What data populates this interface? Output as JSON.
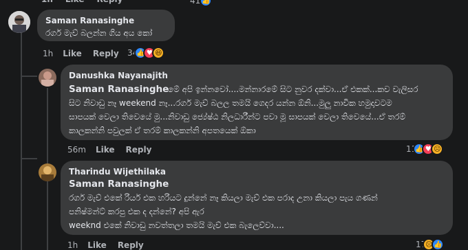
{
  "top_partial": {
    "time": "1h",
    "like": "Like",
    "reply": "Reply",
    "count": "41"
  },
  "comments": [
    {
      "author": "Saman Ranasinghe",
      "text_lines": [
        "රගර් මැච් බලන්න ගිය අය කෝ"
      ],
      "time": "1h",
      "like": "Like",
      "reply": "Reply",
      "reaction_count": "34",
      "reactions": [
        "like-icon",
        "love-icon",
        "haha-icon"
      ]
    },
    {
      "author": "Danushka Nayanajith",
      "mention": "Saman Ranasinghe",
      "text_lines": [
        "මේ අපි ඉන්නවෝ....මන්නාරමේ සිට නුවර දක්වා...ඒ එකක්...කව වැලිසර",
        "සිට නිවාඩු නෑ weekend නෑ...රගර් මැච් බලල තමයි ගෙදර යන්න ඕනි...මුලු නාවික හමුදාවටම",
        "සාපයක් වෙලා තිවෙයේ මු...නිවාඩු ජ්‍යේෂ්ඨ නිලධාරීන්ට පවා මූ සාපයක් වෙලා තිවෙයේ...ඒ තරම්",
        "කාලකන්නි පවුලක් ඒ තරම් කාලකන්නි අපතයෙක් ඕකා"
      ],
      "time": "56m",
      "like": "Like",
      "reply": "Reply",
      "reaction_count": "11",
      "reactions": [
        "like-icon",
        "love-icon",
        "sad-icon"
      ]
    },
    {
      "author": "Tharindu Wijethilaka",
      "mention": "Saman Ranasinghe",
      "text_lines": [
        "රගර් මැච් එකේ රියර් එක හරියට දුන්නේ නෑ කියලා මැච් එක පරාද උනා කියලා පැය ගණන්",
        "පනිෂ්මන්ට් කරපු එක ද දන්නේ? අපි ඇර",
        "weeknd එකේ නිවාඩු නවත්තලා තමයි මැච් එක බැලෙව්වා...."
      ],
      "time": "1h",
      "like": "Like",
      "reply": "Reply",
      "reaction_count": "17",
      "reactions": [
        "sad-icon",
        "like-icon"
      ]
    }
  ],
  "colors": {
    "background": "#18191a",
    "bubble": "#3a3b3c",
    "text_primary": "#e4e6eb",
    "text_secondary": "#b0b3b8",
    "like_blue": "#2d88ff",
    "love_red": "#f33e58",
    "haha_yellow": "#f7b125"
  }
}
